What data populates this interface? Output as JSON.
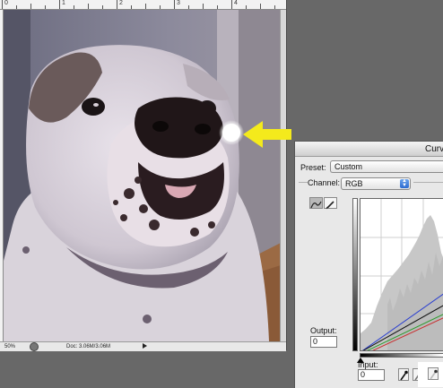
{
  "document": {
    "ruler_numbers": [
      "0",
      "1",
      "2",
      "3",
      "4"
    ],
    "status": {
      "zoom": "50%",
      "doc_info": "Doc: 3.06M/3.06M"
    }
  },
  "curves_dialog": {
    "title": "Curv",
    "preset_label": "Preset:",
    "preset_value": "Custom",
    "channel_label": "Channel:",
    "channel_value": "RGB",
    "output_label": "Output:",
    "output_value": "0",
    "input_label": "Input:",
    "input_value": "0"
  },
  "colors": {
    "annotation_arrow": "#f4ea1c",
    "blue_curve": "#2a3fd0",
    "green_curve": "#2c9a2c",
    "red_curve": "#c83030",
    "histogram": "#c7c7c7"
  },
  "icons": [
    "navigator-icon",
    "status-menu-arrow-icon",
    "curve-tool-icon",
    "pencil-tool-icon",
    "black-eyedropper-icon",
    "gray-eyedropper-icon",
    "white-eyedropper-icon",
    "yellow-arrow-icon"
  ]
}
